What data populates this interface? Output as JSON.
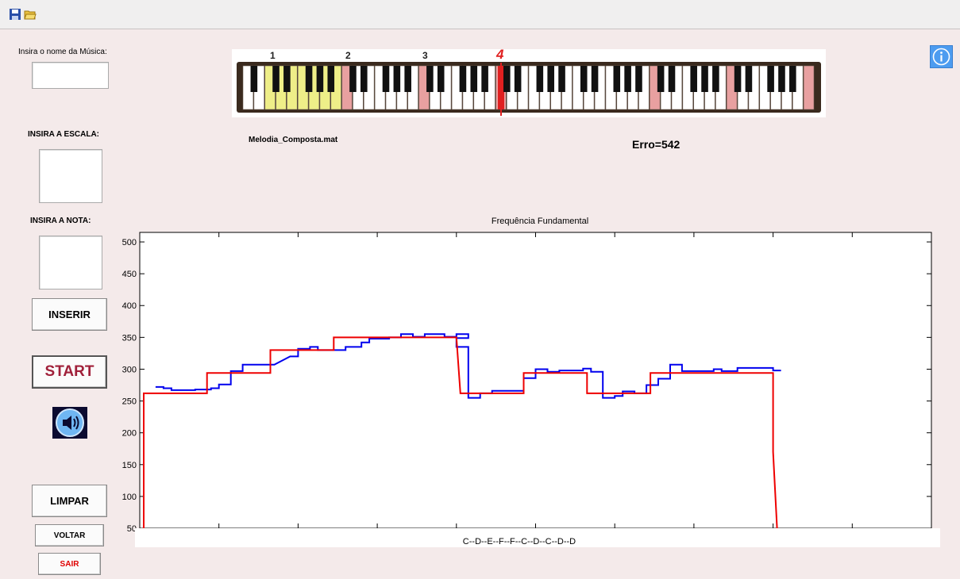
{
  "labels": {
    "song_name": "Insira o nome da Música:",
    "scale": "INSIRA A ESCALA:",
    "note": "INSIRA A NOTA:",
    "file_name": "Melodia_Composta.mat",
    "error": "Erro=542"
  },
  "inputs": {
    "song_name_value": "",
    "scale_value": "",
    "note_value": ""
  },
  "buttons": {
    "inserir": "INSERIR",
    "start": "START",
    "limpar": "LIMPAR",
    "voltar": "VOLTAR",
    "sair": "SAIR"
  },
  "keyboard": {
    "octave_labels": [
      "1",
      "2",
      "3",
      "4"
    ],
    "highlight_color": "#eeee88",
    "marker_color": "#e8a0a0",
    "active_color": "#e02020"
  },
  "colors": {
    "start_text": "#a0203a",
    "sair_text": "#e00000",
    "series_detected": "#0000ee",
    "series_reference": "#ee0000"
  },
  "chart_data": {
    "type": "line",
    "title": "Frequência Fundamental",
    "xlabel": "C--D--E--F--F--C--D--C--D--D",
    "ylabel": "",
    "ylim": [
      50,
      515
    ],
    "xlim": [
      0,
      10
    ],
    "yticks": [
      50,
      100,
      150,
      200,
      250,
      300,
      350,
      400,
      450,
      500
    ],
    "yticklabels": [
      "50",
      "100",
      "150",
      "200",
      "250",
      "300",
      "350",
      "400",
      "450",
      "500"
    ],
    "series": [
      {
        "points": [
          [
            0.2,
            272
          ],
          [
            0.3,
            272
          ],
          [
            0.3,
            270
          ],
          [
            0.4,
            270
          ],
          [
            0.4,
            267
          ],
          [
            0.7,
            267
          ],
          [
            0.7,
            268
          ],
          [
            0.9,
            268
          ],
          [
            0.9,
            270
          ],
          [
            1.0,
            270
          ],
          [
            1.0,
            276
          ],
          [
            1.15,
            276
          ],
          [
            1.15,
            297
          ],
          [
            1.3,
            297
          ],
          [
            1.3,
            307
          ],
          [
            1.7,
            307
          ],
          [
            1.9,
            320
          ],
          [
            2.0,
            320
          ],
          [
            2.0,
            332
          ],
          [
            2.15,
            332
          ],
          [
            2.15,
            335
          ],
          [
            2.25,
            335
          ],
          [
            2.25,
            330
          ],
          [
            2.6,
            330
          ],
          [
            2.6,
            335
          ],
          [
            2.8,
            335
          ],
          [
            2.8,
            342
          ],
          [
            2.9,
            342
          ],
          [
            2.9,
            348
          ],
          [
            3.15,
            348
          ],
          [
            3.15,
            350
          ],
          [
            3.3,
            350
          ],
          [
            3.3,
            355
          ],
          [
            3.45,
            355
          ],
          [
            3.45,
            351
          ],
          [
            3.6,
            351
          ],
          [
            3.6,
            355
          ],
          [
            3.85,
            355
          ],
          [
            3.85,
            351
          ],
          [
            4.0,
            351
          ],
          [
            4.0,
            355
          ],
          [
            4.15,
            355
          ],
          [
            4.15,
            349
          ],
          [
            4.05,
            349
          ],
          [
            4.0,
            349
          ],
          [
            4.0,
            335
          ],
          [
            4.15,
            335
          ],
          [
            4.15,
            255
          ],
          [
            4.3,
            255
          ],
          [
            4.3,
            262
          ],
          [
            4.45,
            262
          ],
          [
            4.45,
            266
          ],
          [
            4.8,
            266
          ],
          [
            4.85,
            266
          ],
          [
            4.85,
            286
          ],
          [
            5.0,
            286
          ],
          [
            5.0,
            300
          ],
          [
            5.15,
            300
          ],
          [
            5.15,
            296
          ],
          [
            5.3,
            296
          ],
          [
            5.3,
            298
          ],
          [
            5.6,
            298
          ],
          [
            5.6,
            301
          ],
          [
            5.7,
            301
          ],
          [
            5.7,
            296
          ],
          [
            5.85,
            296
          ],
          [
            5.85,
            255
          ],
          [
            6.0,
            255
          ],
          [
            6.0,
            258
          ],
          [
            6.1,
            258
          ],
          [
            6.1,
            265
          ],
          [
            6.25,
            265
          ],
          [
            6.25,
            262
          ],
          [
            6.4,
            262
          ],
          [
            6.4,
            275
          ],
          [
            6.55,
            275
          ],
          [
            6.55,
            285
          ],
          [
            6.7,
            285
          ],
          [
            6.7,
            307
          ],
          [
            6.85,
            307
          ],
          [
            6.85,
            297
          ],
          [
            7.25,
            297
          ],
          [
            7.25,
            300
          ],
          [
            7.35,
            300
          ],
          [
            7.35,
            297
          ],
          [
            7.55,
            297
          ],
          [
            7.55,
            302
          ],
          [
            8.0,
            302
          ],
          [
            8.0,
            298
          ],
          [
            8.1,
            298
          ]
        ]
      },
      {
        "points": [
          [
            0.05,
            50
          ],
          [
            0.05,
            262
          ],
          [
            0.85,
            262
          ],
          [
            0.85,
            294
          ],
          [
            1.65,
            294
          ],
          [
            1.65,
            330
          ],
          [
            2.45,
            330
          ],
          [
            2.45,
            350
          ],
          [
            4.0,
            350
          ],
          [
            4.05,
            262
          ],
          [
            4.85,
            262
          ],
          [
            4.85,
            294
          ],
          [
            5.65,
            294
          ],
          [
            5.65,
            262
          ],
          [
            6.45,
            262
          ],
          [
            6.45,
            294
          ],
          [
            8.0,
            294
          ],
          [
            8.0,
            170
          ],
          [
            8.05,
            50
          ]
        ]
      }
    ]
  }
}
